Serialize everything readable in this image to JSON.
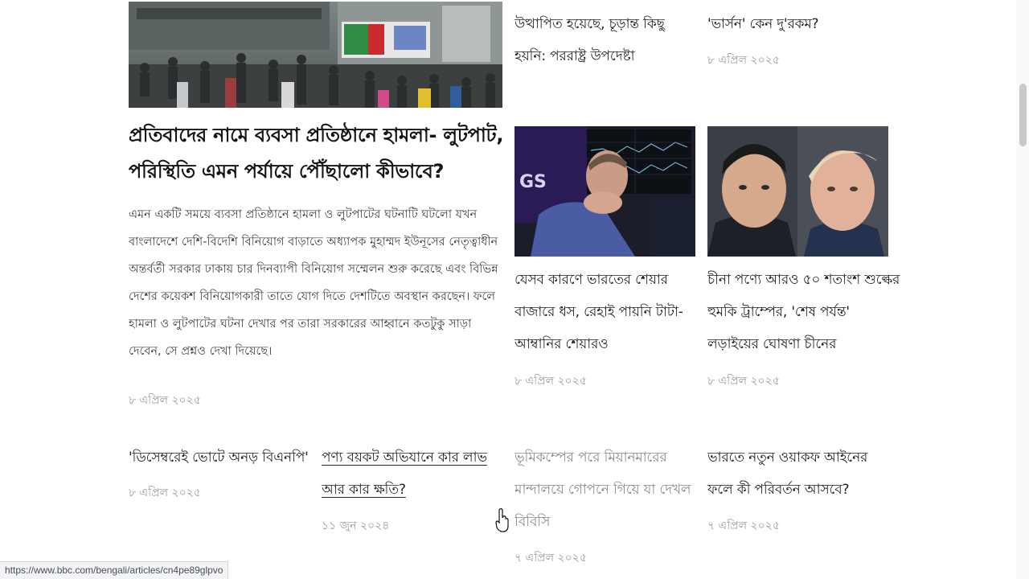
{
  "lead": {
    "title": "প্রতিবাদের নামে ব্যবসা প্রতিষ্ঠানে হামলা- লুটপাট, পরিস্থিতি এমন পর্যায়ে পৌঁছালো কীভাবে?",
    "summary": "এমন একটি সময়ে ব্যবসা প্রতিষ্ঠানে হামলা ও লুটপাটের ঘটনাটি ঘটলো যখন বাংলাদেশে দেশি-বিদেশি বিনিয়োগ বাড়াতে অধ্যাপক মুহাম্মদ ইউনূসের নেতৃত্বাধীন অন্তর্বর্তী সরকার ঢাকায় চার দিনব্যাপী বিনিয়োগ সম্মেলন শুরু করেছে এবং বিভিন্ন দেশের কয়েকশ বিনিয়োগকারী তাতে যোগ দিতে দেশটিতে অবস্থান করছেন। ফলে হামলা ও লুটপাটের ঘটনা দেখার পর তারা সরকারের আহ্বানে কতটুকু সাড়া দেবেন, সে প্রশ্নও দেখা দিয়েছে।",
    "date": "৮ এপ্রিল ২০২৫",
    "image": "crowd-protest-photo"
  },
  "top_right": [
    {
      "title": "উত্থাপিত হয়েছে, চূড়ান্ত কিছু হয়নি: পররাষ্ট্র উপদেষ্টা",
      "date": ""
    },
    {
      "title": "'ভার্সন' কেন দু'রকম?",
      "date": "৮ এপ্রিল ২০২৫"
    }
  ],
  "mid": [
    {
      "title": "যেসব কারণে ভারতের শেয়ার বাজারে ধস, রেহাই পায়নি টাটা-আম্বানির শেয়ারও",
      "date": "৮ এপ্রিল ২০২৫",
      "image": "stock-trader-photo"
    },
    {
      "title": "চীনা পণ্যে আরও ৫০ শতাংশ শুল্কের হুমকি ট্রাম্পের, 'শেষ পর্যন্ত' লড়াইয়ের ঘোষণা চীনের",
      "date": "৮ এপ্রিল ২০২৫",
      "image": "xi-trump-photo"
    }
  ],
  "bottom": [
    {
      "title": "'ডিসেম্বরেই ভোটে অনড় বিএনপি'",
      "date": "৮ এপ্রিল ২০২৫"
    },
    {
      "title": "পণ্য বয়কট অভিযানে কার লাভ আর কার ক্ষতি?",
      "date": "১১ জুন ২০২৪"
    },
    {
      "title": "ভূমিকম্পের পরে মিয়ানমারের মান্দালয়ে গোপনে গিয়ে যা দেখল বিবিসি",
      "date": "৭ এপ্রিল ২০২৫"
    },
    {
      "title": "ভারতে নতুন ওয়াকফ আইনের ফলে কী পরিবর্তন আসবে?",
      "date": "৭ এপ্রিল ২০২৫"
    }
  ],
  "status_bar": {
    "url": "https://www.bbc.com/bengali/articles/cn4pe89glpvo"
  }
}
